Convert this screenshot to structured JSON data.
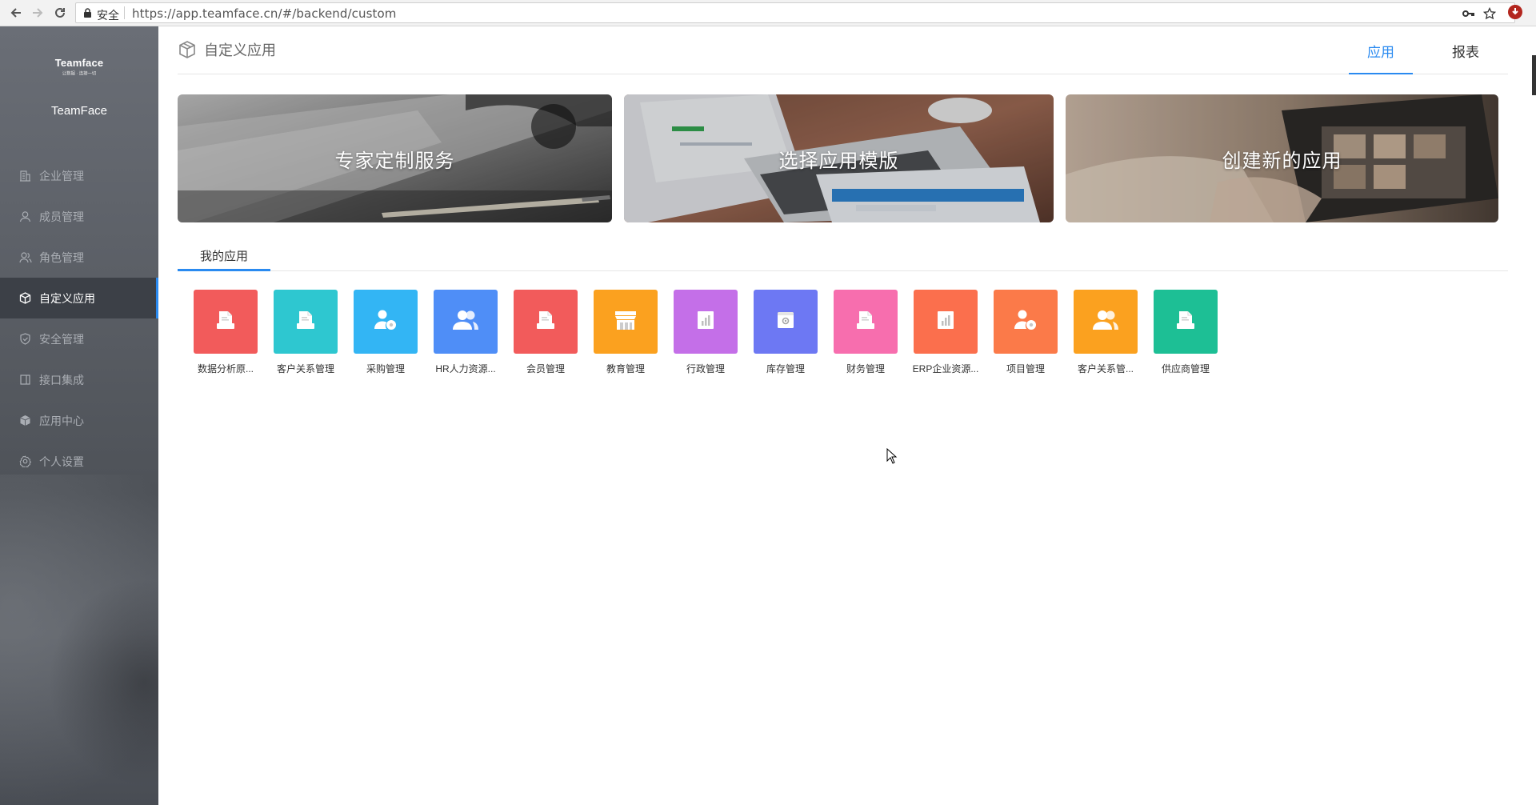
{
  "browser": {
    "secure_label": "安全",
    "url": "https://app.teamface.cn/#/backend/custom"
  },
  "sidebar": {
    "logo_brand": "Teamface",
    "logo_slogan": "让数据 · 连接一切",
    "company": "TeamFace",
    "items": [
      {
        "label": "企业管理",
        "icon": "building-icon"
      },
      {
        "label": "成员管理",
        "icon": "user-icon"
      },
      {
        "label": "角色管理",
        "icon": "users-icon"
      },
      {
        "label": "自定义应用",
        "icon": "cube-icon",
        "active": true
      },
      {
        "label": "安全管理",
        "icon": "shield-icon"
      },
      {
        "label": "接口集成",
        "icon": "plug-icon"
      },
      {
        "label": "应用中心",
        "icon": "box-icon"
      },
      {
        "label": "个人设置",
        "icon": "gear-icon"
      }
    ]
  },
  "header": {
    "title": "自定义应用",
    "tabs": [
      {
        "label": "应用",
        "active": true
      },
      {
        "label": "报表",
        "active": false
      }
    ]
  },
  "banners": [
    {
      "label": "专家定制服务"
    },
    {
      "label": "选择应用模版"
    },
    {
      "label": "创建新的应用"
    }
  ],
  "section": {
    "tab_label": "我的应用"
  },
  "apps": [
    {
      "label": "数据分析原...",
      "color": "#f25b5b",
      "icon": "document-icon"
    },
    {
      "label": "客户关系管理",
      "color": "#2ec7d0",
      "icon": "document-icon"
    },
    {
      "label": "采购管理",
      "color": "#33b5f4",
      "icon": "user-gear-icon"
    },
    {
      "label": "HR人力资源...",
      "color": "#4f8ef7",
      "icon": "users-icon"
    },
    {
      "label": "会员管理",
      "color": "#f25b5b",
      "icon": "document-icon"
    },
    {
      "label": "教育管理",
      "color": "#fba11f",
      "icon": "store-icon"
    },
    {
      "label": "行政管理",
      "color": "#c46fe8",
      "icon": "report-icon"
    },
    {
      "label": "库存管理",
      "color": "#6d78f3",
      "icon": "box-gear-icon"
    },
    {
      "label": "财务管理",
      "color": "#f76eae",
      "icon": "document-icon"
    },
    {
      "label": "ERP企业资源...",
      "color": "#fb6f4d",
      "icon": "report-icon"
    },
    {
      "label": "项目管理",
      "color": "#fb7a49",
      "icon": "user-gear-icon"
    },
    {
      "label": "客户关系管...",
      "color": "#fba11f",
      "icon": "users-icon"
    },
    {
      "label": "供应商管理",
      "color": "#1dbf95",
      "icon": "document-icon"
    }
  ]
}
